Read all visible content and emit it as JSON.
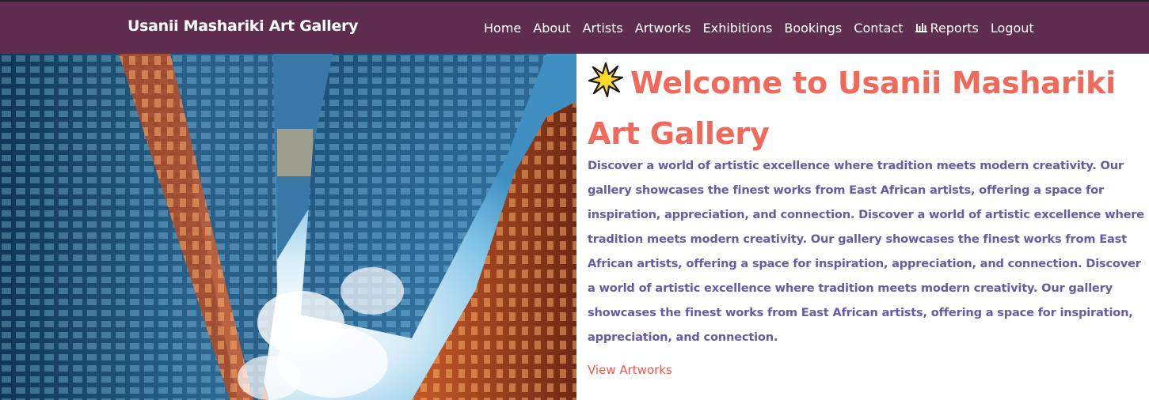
{
  "navbar": {
    "brand": "Usanii Mashariki Art Gallery",
    "links": [
      {
        "label": "Home"
      },
      {
        "label": "About"
      },
      {
        "label": "Artists"
      },
      {
        "label": "Artworks"
      },
      {
        "label": "Exhibitions"
      },
      {
        "label": "Bookings"
      },
      {
        "label": "Contact"
      },
      {
        "label": "Reports",
        "icon": "bar-chart-icon"
      },
      {
        "label": "Logout"
      }
    ],
    "background": "#5f2d4f"
  },
  "hero": {
    "image": {
      "subject": "skyscrapers viewed from below against a cloudy blue sky"
    },
    "title": "Welcome to Usanii Mashariki Art Gallery",
    "title_icon": "sparkle-star-icon",
    "description": "Discover a world of artistic excellence where tradition meets modern creativity. Our gallery showcases the finest works from East African artists, offering a space for inspiration, appreciation, and connection. Discover a world of artistic excellence where tradition meets modern creativity. Our gallery showcases the finest works from East African artists, offering a space for inspiration, appreciation, and connection. Discover a world of artistic excellence where tradition meets modern creativity. Our gallery showcases the finest works from East African artists, offering a space for inspiration, appreciation, and connection.",
    "cta_label": "View Artworks",
    "colors": {
      "title": "#f06a5c",
      "description": "#6a5aa6",
      "cta": "#f0584a"
    }
  }
}
